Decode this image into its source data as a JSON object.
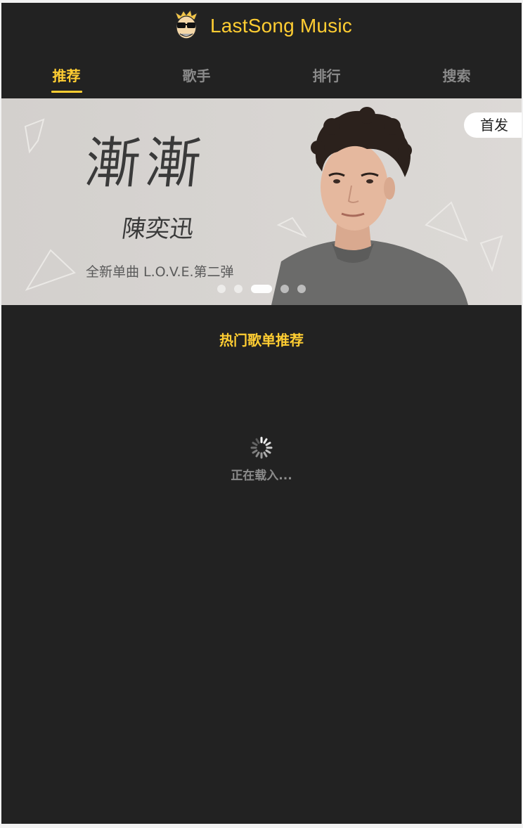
{
  "header": {
    "logo_icon": "cartoon-mascot-logo",
    "title": "LastSong Music"
  },
  "tabs": [
    {
      "label": "推荐",
      "active": true
    },
    {
      "label": "歌手",
      "active": false
    },
    {
      "label": "排行",
      "active": false
    },
    {
      "label": "搜索",
      "active": false
    }
  ],
  "banner": {
    "title": "漸漸",
    "artist": "陳奕迅",
    "subtitle": "全新单曲 L.O.V.E.第二弹",
    "badge": "首发",
    "slide_count": 5,
    "active_slide": 3
  },
  "section": {
    "title": "热门歌单推荐"
  },
  "loading": {
    "icon": "spinner-icon",
    "text": "正在载入..."
  },
  "colors": {
    "accent": "#ffcd32",
    "background": "#222222",
    "muted_text": "#8a8a8a"
  }
}
